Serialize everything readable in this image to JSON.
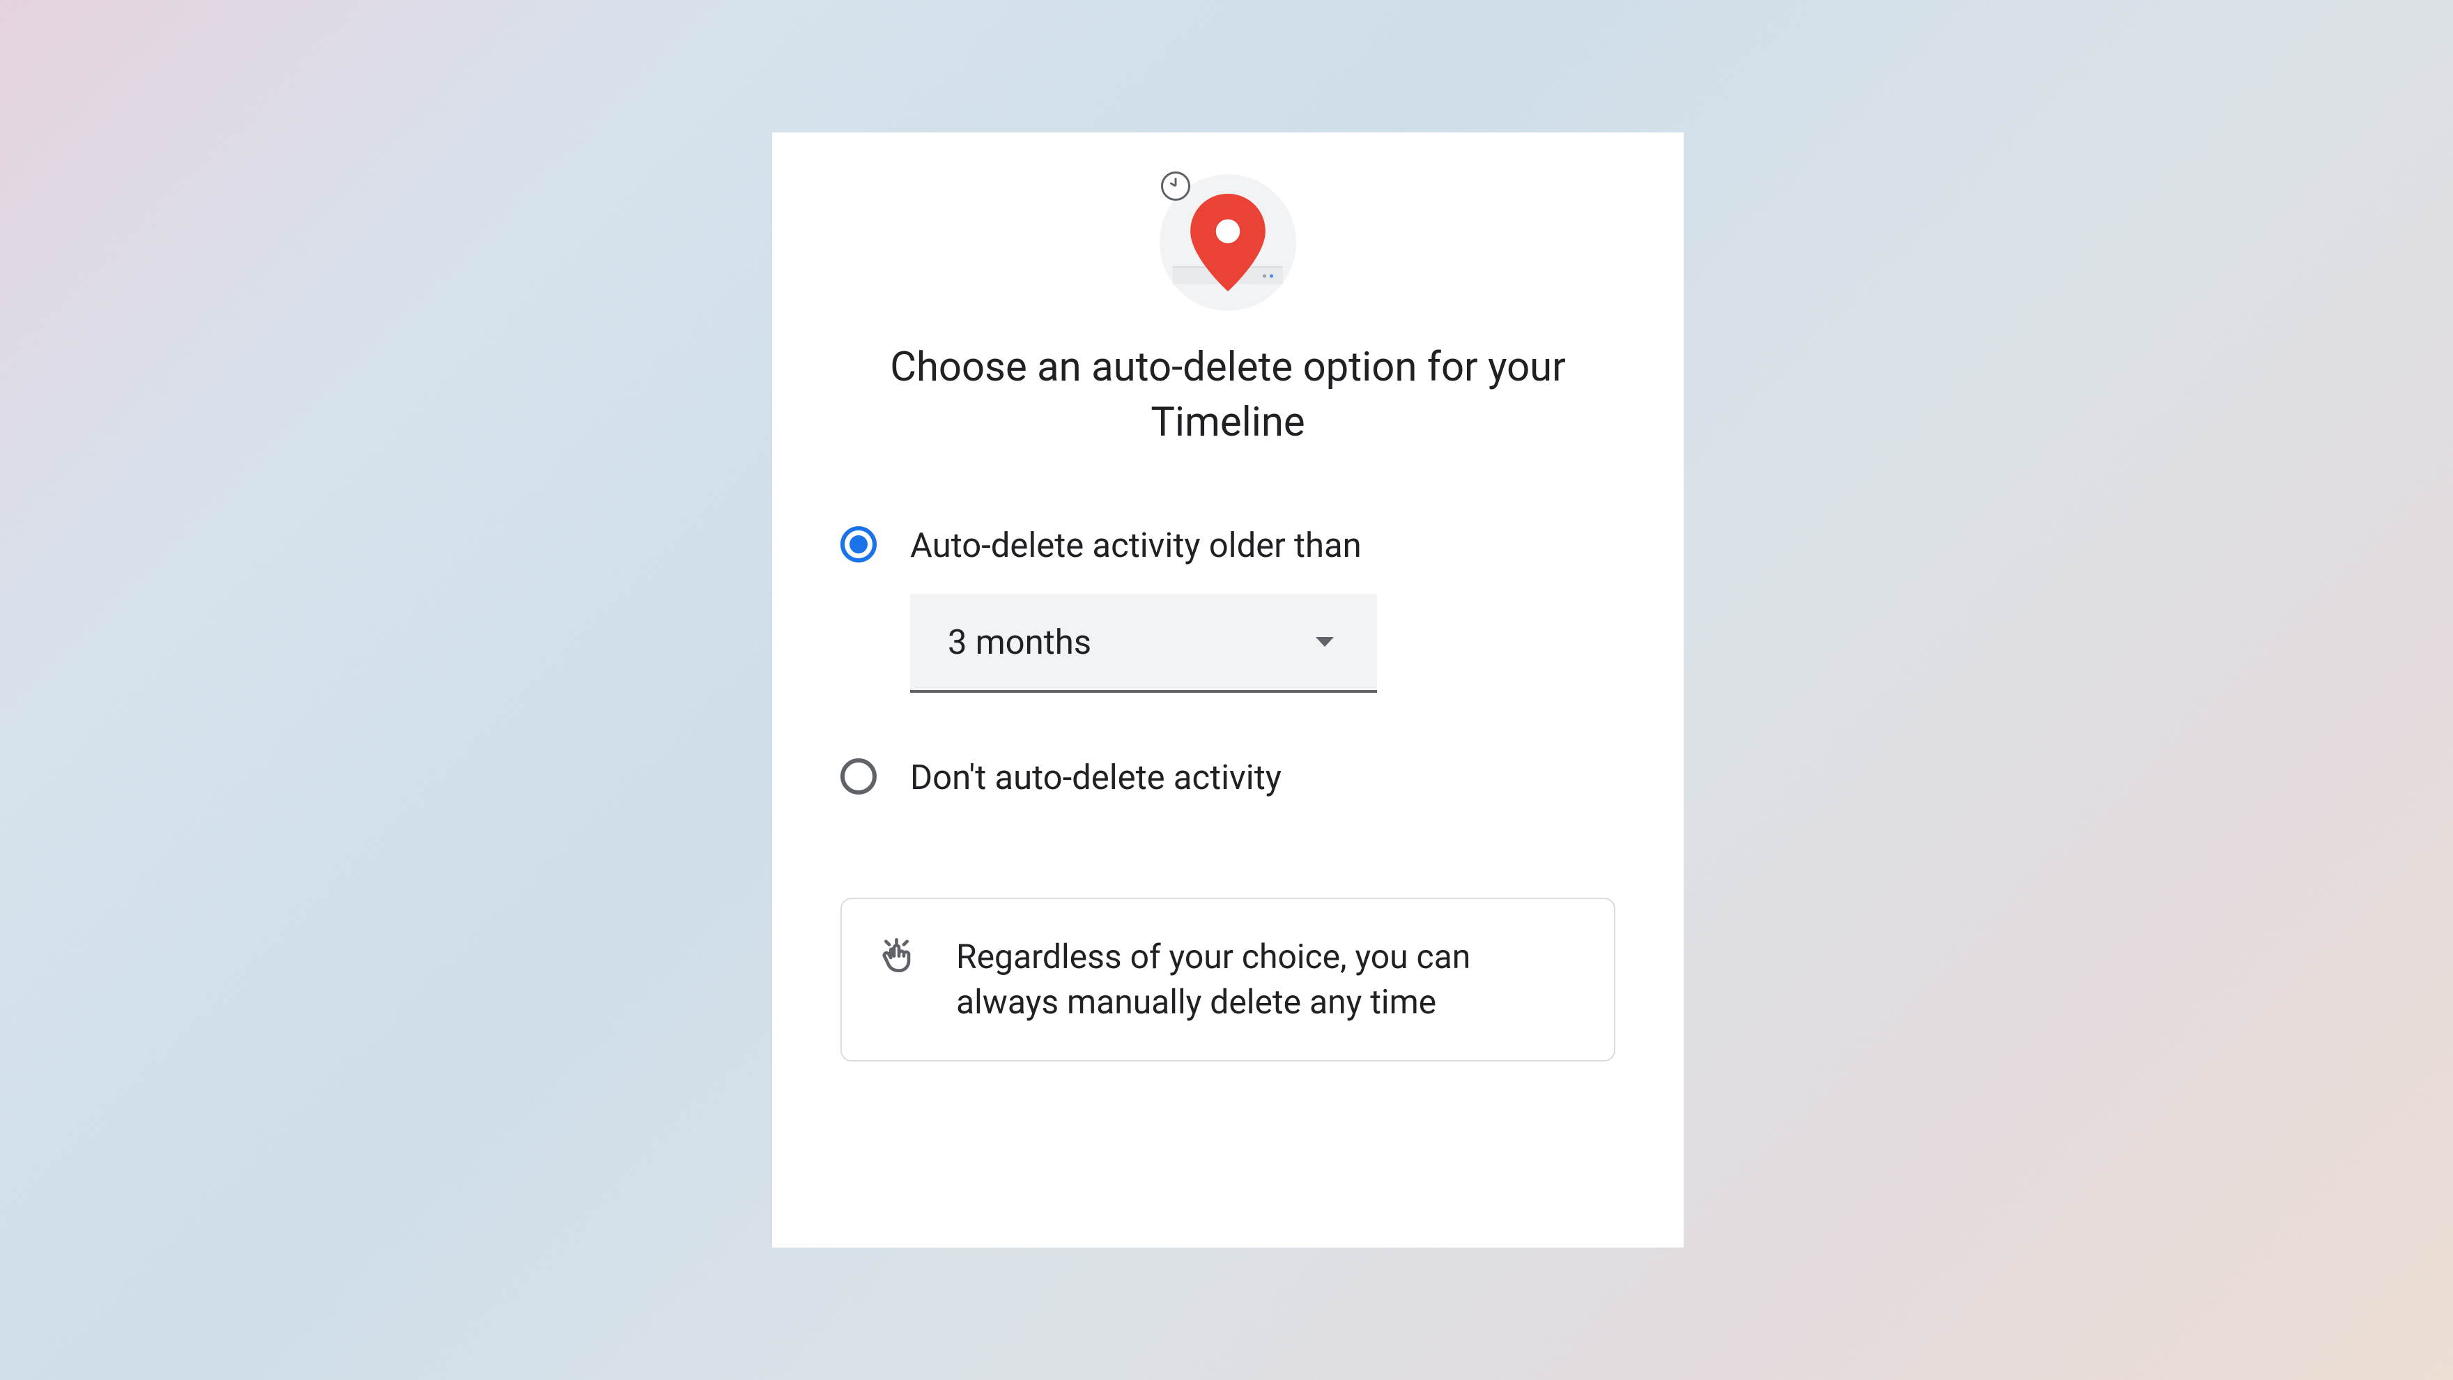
{
  "title": "Choose an auto-delete option for your Timeline",
  "options": {
    "auto_delete": {
      "label": "Auto-delete activity older than",
      "selected": true,
      "dropdown_value": "3 months"
    },
    "dont_delete": {
      "label": "Don't auto-delete activity",
      "selected": false
    }
  },
  "info": {
    "text": "Regardless of your choice, you can always manually delete any time"
  }
}
